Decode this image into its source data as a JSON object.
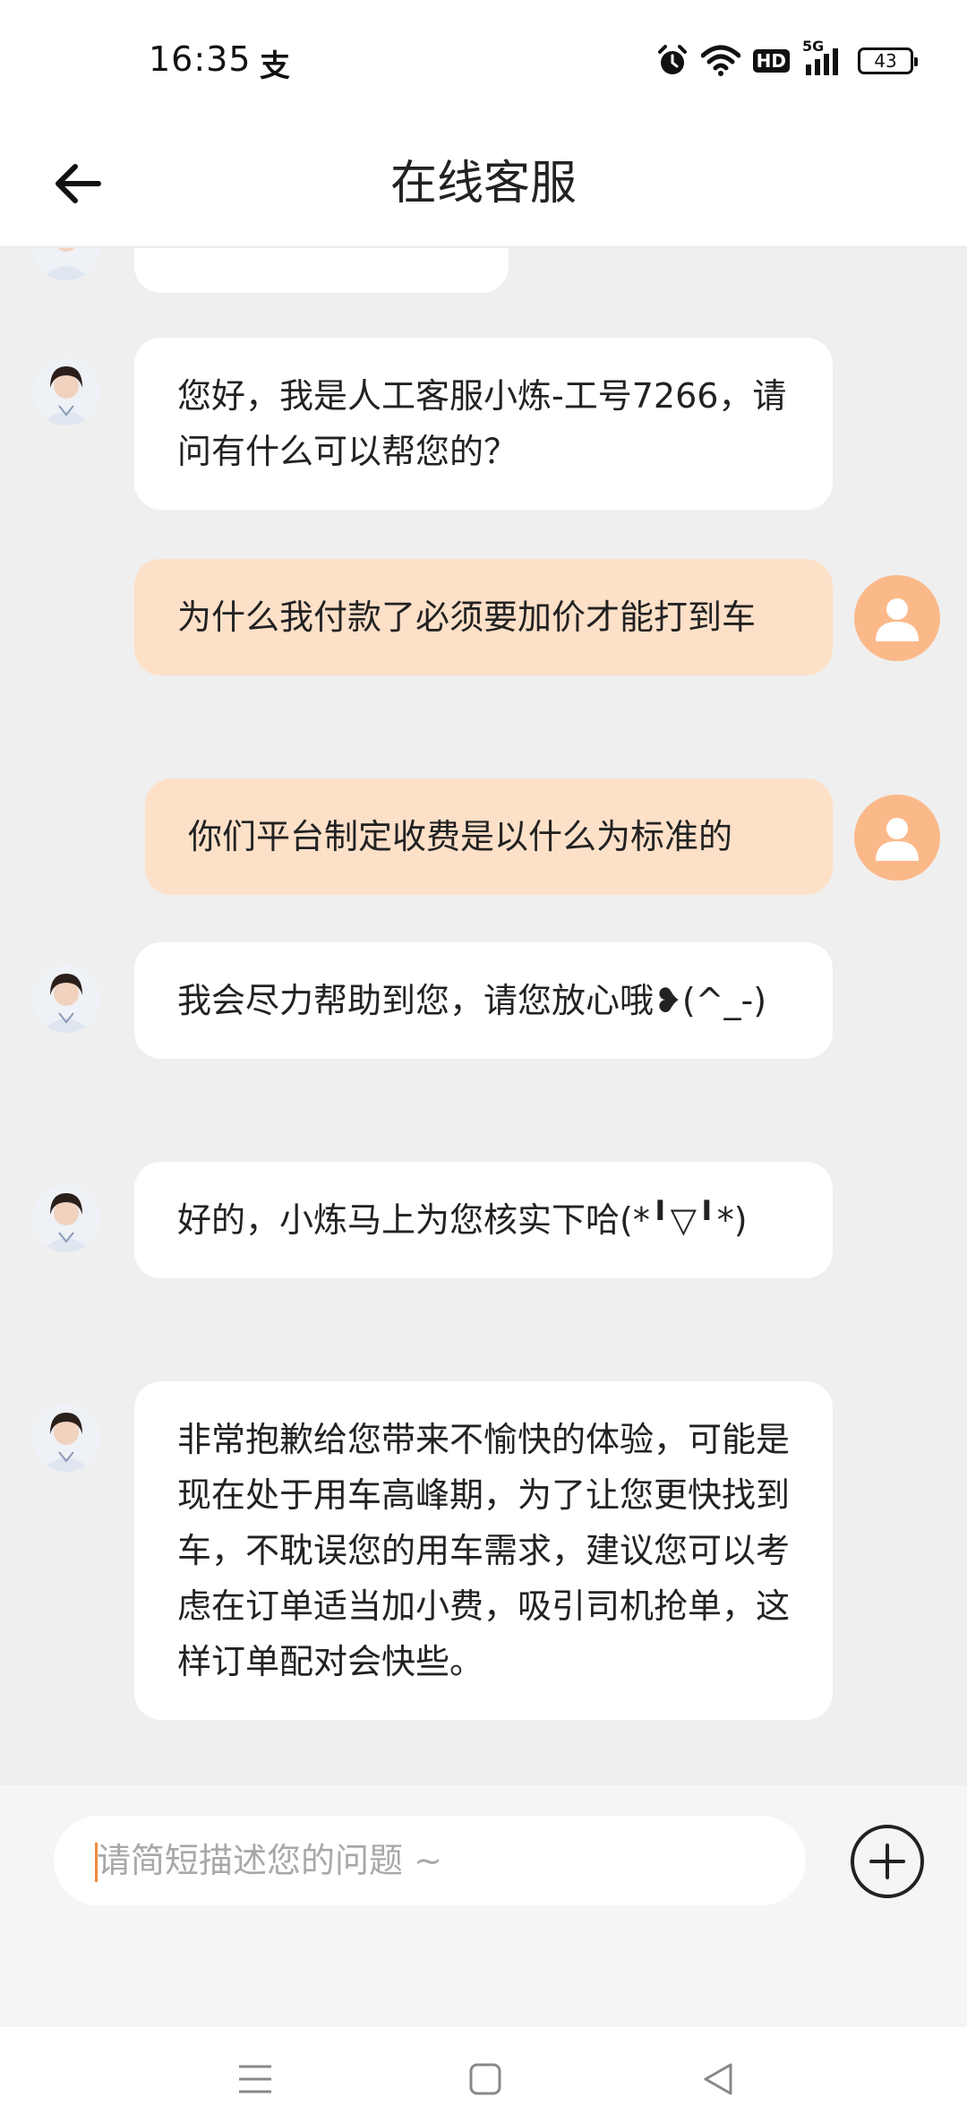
{
  "status_bar": {
    "time": "16:35",
    "alipay_glyph": "支",
    "hd_label": "HD",
    "network_label": "5G",
    "battery": "43",
    "icons": [
      "alarm-icon",
      "wifi-icon",
      "hd-icon",
      "signal-icon",
      "battery-icon"
    ]
  },
  "header": {
    "title": "在线客服",
    "back_icon": "arrow-left-icon"
  },
  "messages": [
    {
      "sender": "agent",
      "text": "您好，我是人工客服小炼-工号7266，请问有什么可以帮您的？"
    },
    {
      "sender": "user",
      "text": "为什么我付款了必须要加价才能打到车"
    },
    {
      "sender": "user",
      "text": "你们平台制定收费是以什么为标准的"
    },
    {
      "sender": "agent",
      "text": "我会尽力帮助到您，请您放心哦❥(^_-)"
    },
    {
      "sender": "agent",
      "text": "好的，小炼马上为您核实下哈(*╹▽╹*)"
    },
    {
      "sender": "agent",
      "text": "非常抱歉给您带来不愉快的体验，可能是现在处于用车高峰期，为了让您更快找到车，不耽误您的用车需求，建议您可以考虑在订单适当加小费，吸引司机抢单，这样订单配对会快些。"
    }
  ],
  "input": {
    "placeholder": "请简短描述您的问题 ~",
    "plus_icon": "plus-circle-icon"
  },
  "nav": [
    "menu-icon",
    "home-square-icon",
    "back-triangle-icon"
  ],
  "colors": {
    "user_bubble": "#fde0c8",
    "user_avatar": "#fbb98a",
    "agent_bubble": "#ffffff",
    "background": "#efefef",
    "caret": "#f08a3c"
  }
}
